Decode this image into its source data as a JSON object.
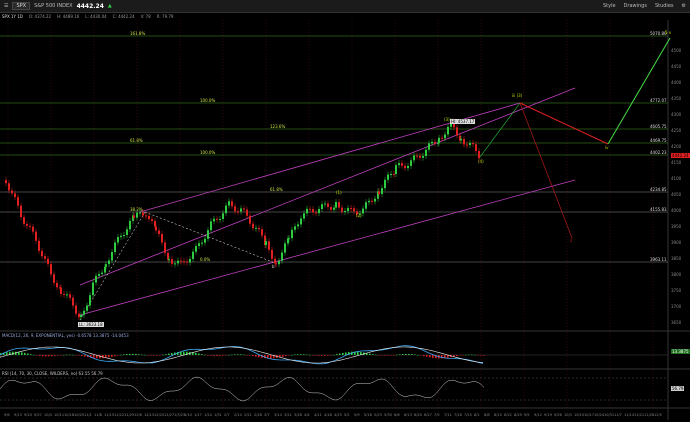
{
  "toolbar": {
    "symbol": "SPX",
    "symbol_desc": "S&P 500 INDEX",
    "last_price": "4442.24",
    "change": "▲",
    "buttons": [
      "Style",
      "Drawings",
      "Studies"
    ],
    "period": "1 D"
  },
  "info_bar": {
    "symbol": "SPX 1Y 1D",
    "open": "O: 4374.22",
    "high": "H: 4489.16",
    "low": "L: 4430.04",
    "close": "C: 4442.24",
    "vol": "V: 78",
    "extra": "R: 79.79"
  },
  "fib_levels": [
    {
      "pct": "161.8%",
      "price": "5070.80"
    },
    {
      "pct": "100.0%",
      "price": "4772.07"
    },
    {
      "pct": "123.6%",
      "price": "4605.75"
    },
    {
      "pct": "61.8%",
      "price": "4469.75"
    },
    {
      "pct": "100.0%",
      "price": "4402.23"
    },
    {
      "pct": "61.8%",
      "price": "4234.85"
    },
    {
      "pct": "38.2%",
      "price": "4155.83"
    },
    {
      "pct": "0.0%",
      "price": "3963.11"
    }
  ],
  "wave_labels": {
    "w1": "(1)",
    "w2": "(2)",
    "w3": "(3)",
    "w4": "(4)",
    "wiii": "iii (3)",
    "wiv": "iv",
    "wv": "5 v",
    "w2b": "2",
    "wb": "b",
    "low_tag": "LL: 3633.18",
    "hi_tag": "HI: 4537.17"
  },
  "price_axis": [
    "4500",
    "4450",
    "4400",
    "4350",
    "4300",
    "4250",
    "4200",
    "4150",
    "4100",
    "4050",
    "4000",
    "3950",
    "3900",
    "3850",
    "3800",
    "3750",
    "3700",
    "3650"
  ],
  "macd_label": "MACD(12, 26, 9, EXPONENTIAL, yes)  -0.6578  13.3875  -14.0453",
  "macd_value": "13.3875",
  "rsi_label": "RSI (14, 70, 30, CLOSE, WILDERS, no)  63.55  56.79",
  "rsi_value": "56.79",
  "date_axis": [
    "9/6",
    "9/13",
    "9/20",
    "9/27",
    "10/4",
    "10/11",
    "10/18",
    "10/25",
    "11/1",
    "11/8",
    "11/15",
    "11/22",
    "11/29",
    "12/6",
    "12/13",
    "12/20",
    "12/27",
    "1/3/23",
    "1/10",
    "1/17",
    "1/24",
    "1/31",
    "2/7",
    "2/14",
    "2/21",
    "2/28",
    "3/7",
    "3/14",
    "3/21",
    "3/28",
    "4/4",
    "4/11",
    "4/18",
    "4/25",
    "5/2",
    "5/9",
    "5/16",
    "5/23",
    "5/30",
    "6/6",
    "6/13",
    "6/20",
    "6/27",
    "7/5",
    "7/11",
    "7/18",
    "7/25",
    "8/1",
    "8/8",
    "8/15",
    "8/22",
    "8/29",
    "9/5",
    "9/12",
    "9/19",
    "9/26",
    "10/3",
    "10/10",
    "10/17",
    "10/24",
    "10/31",
    "11/7",
    "11/14",
    "11/21",
    "11/28",
    "12/5",
    "12/12"
  ]
}
